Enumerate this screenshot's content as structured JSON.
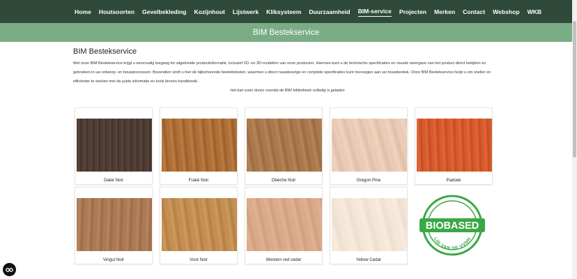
{
  "nav": {
    "items": [
      {
        "label": "Home",
        "active": false
      },
      {
        "label": "Houtsoorten",
        "active": false
      },
      {
        "label": "Gevelbekleding",
        "active": false
      },
      {
        "label": "Kozijnhout",
        "active": false
      },
      {
        "label": "Lijstwerk",
        "active": false
      },
      {
        "label": "Kliksysteem",
        "active": false
      },
      {
        "label": "Duurzaamheid",
        "active": false
      },
      {
        "label": "BIM-service",
        "active": true
      },
      {
        "label": "Projecten",
        "active": false
      },
      {
        "label": "Merken",
        "active": false
      },
      {
        "label": "Contact",
        "active": false
      },
      {
        "label": "Webshop",
        "active": false
      },
      {
        "label": "WKB",
        "active": false
      }
    ]
  },
  "banner": {
    "title": "BIM Bestekservice"
  },
  "content": {
    "heading": "BIM Bestekservice",
    "description": "Met onze BIM Bestekservice krijgt u eenvoudig toegang tot uitgebreide productinformatie, inclusief 2D- en 3D-modellen van onze producten. Hiermee kunt u de technische specificaties en visuele weergave van het product direct bekijken en gebruiken in uw ontwerp- en bouwprocessen. Bovendien vindt u hier de bijbehorende bestekteksten, waarmee u direct nauwkeurige en complete specificaties kunt toevoegen aan uw bouwbestek. Onze BIM Bestekservice helpt u om sneller en efficiënter te werken met de juiste informatie en tools binnen handbereik.",
    "loading_note": "Het kan even duren voordat de BIM bibliotheek volledig is geladen"
  },
  "products": [
    {
      "name": "Dabé Noir",
      "swatch": "dabe"
    },
    {
      "name": "Fraké Noir",
      "swatch": "frake"
    },
    {
      "name": "Obèche Noir",
      "swatch": "obeche"
    },
    {
      "name": "Oregon Pine",
      "swatch": "oregon"
    },
    {
      "name": "Padoek",
      "swatch": "padoek"
    },
    {
      "name": "Vingui Noir",
      "swatch": "vingui"
    },
    {
      "name": "Vuré Noir",
      "swatch": "vure"
    },
    {
      "name": "Western red cedar",
      "swatch": "western"
    },
    {
      "name": "Yellow Cedar",
      "swatch": "yellow"
    }
  ],
  "badge": {
    "text": "BIOBASED",
    "subtext": "LID VAN DE VVNH",
    "color": "#3aa845"
  },
  "colors": {
    "nav_bg": "#2f4a3a",
    "banner_bg": "#7aac86"
  }
}
